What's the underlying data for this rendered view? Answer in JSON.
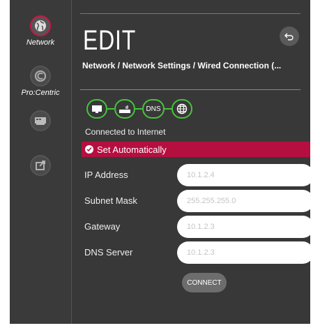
{
  "colors": {
    "accent": "#b50f40",
    "connected_green": "#45c43a"
  },
  "sidebar": {
    "items": [
      {
        "label": "Network",
        "icon": "globe-icon",
        "active": true
      },
      {
        "label": "Pro:Centric",
        "icon": "procentric-icon",
        "active": false
      },
      {
        "label": "",
        "icon": "tv-settings-icon",
        "active": false
      },
      {
        "label": "",
        "icon": "edit-export-icon",
        "active": false
      }
    ]
  },
  "header": {
    "title": "EDIT",
    "back_icon": "back-arrow-icon",
    "breadcrumb": "Network / Network Settings / Wired Connection (..."
  },
  "status": {
    "icons": [
      "tv-icon",
      "router-icon",
      "DNS",
      "internet-globe-icon"
    ],
    "dns_label": "DNS",
    "text": "Connected to Internet"
  },
  "set_automatically": {
    "label": "Set Automatically",
    "checked": true
  },
  "fields": [
    {
      "label": "IP Address",
      "placeholder": "10.1.2.4"
    },
    {
      "label": "Subnet Mask",
      "placeholder": "255.255.255.0"
    },
    {
      "label": "Gateway",
      "placeholder": "10.1.2.3"
    },
    {
      "label": "DNS Server",
      "placeholder": "10.1.2.3"
    }
  ],
  "connect_label": "CONNECT"
}
